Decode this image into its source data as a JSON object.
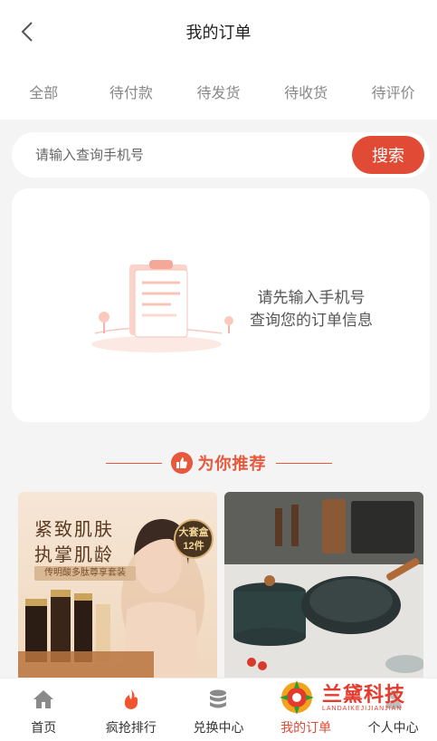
{
  "header": {
    "title": "我的订单"
  },
  "tabs": [
    {
      "label": "全部"
    },
    {
      "label": "待付款"
    },
    {
      "label": "待发货"
    },
    {
      "label": "待收货"
    },
    {
      "label": "待评价"
    }
  ],
  "search": {
    "placeholder": "请输入查询手机号",
    "value": "",
    "button_label": "搜索"
  },
  "empty_state": {
    "line1": "请先输入手机号",
    "line2": "查询您的订单信息"
  },
  "recommend": {
    "title": "为你推荐"
  },
  "products": [
    {
      "title_line1": "紧致肌肤",
      "title_line2": "执掌肌龄",
      "subtitle": "传明酸多肽尊享套装",
      "badge_line1": "大套盒",
      "badge_line2": "12件"
    },
    {
      "title": ""
    }
  ],
  "bottom_nav": [
    {
      "label": "首页",
      "icon": "home-icon"
    },
    {
      "label": "疯抢排行",
      "icon": "flame-icon"
    },
    {
      "label": "兑换中心",
      "icon": "coins-icon"
    },
    {
      "label": "我的订单",
      "icon": "order-icon",
      "active": true
    },
    {
      "label": "个人中心",
      "icon": "user-icon"
    }
  ],
  "watermark": {
    "text": "兰黛科技",
    "sub": "LANDAIKEJIJIANJIAN"
  },
  "colors": {
    "accent": "#e14b36",
    "recommend": "#e8583d",
    "background": "#f4f4f4"
  }
}
